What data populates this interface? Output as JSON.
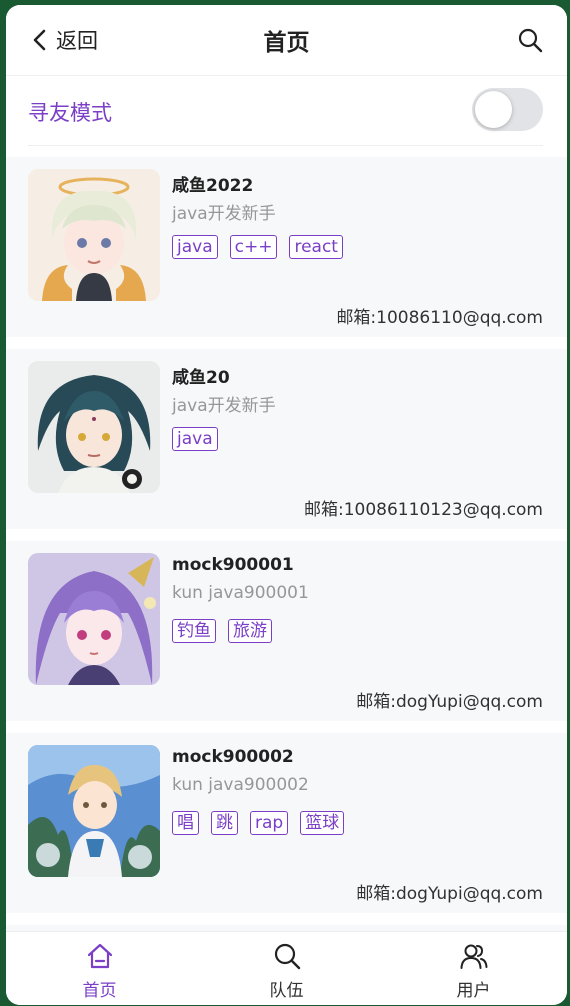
{
  "navbar": {
    "back_label": "返回",
    "title": "首页"
  },
  "mode": {
    "label": "寻友模式",
    "enabled": false
  },
  "users": [
    {
      "name": "咸鱼2022",
      "desc": "java开发新手",
      "tags": [
        "java",
        "c++",
        "react"
      ],
      "email": "邮箱:10086110@qq.com"
    },
    {
      "name": "咸鱼20",
      "desc": "java开发新手",
      "tags": [
        "java"
      ],
      "email": "邮箱:10086110123@qq.com"
    },
    {
      "name": "mock900001",
      "desc": "kun java900001",
      "tags": [
        "钓鱼",
        "旅游"
      ],
      "email": "邮箱:dogYupi@qq.com"
    },
    {
      "name": "mock900002",
      "desc": "kun java900002",
      "tags": [
        "唱",
        "跳",
        "rap",
        "篮球"
      ],
      "email": "邮箱:dogYupi@qq.com"
    }
  ],
  "tabbar": [
    {
      "label": "首页",
      "icon": "home-icon",
      "active": true
    },
    {
      "label": "队伍",
      "icon": "search-icon",
      "active": false
    },
    {
      "label": "用户",
      "icon": "users-icon",
      "active": false
    }
  ],
  "colors": {
    "accent": "#7a3fc6",
    "card_bg": "#f7f8fa",
    "muted": "#969799"
  }
}
